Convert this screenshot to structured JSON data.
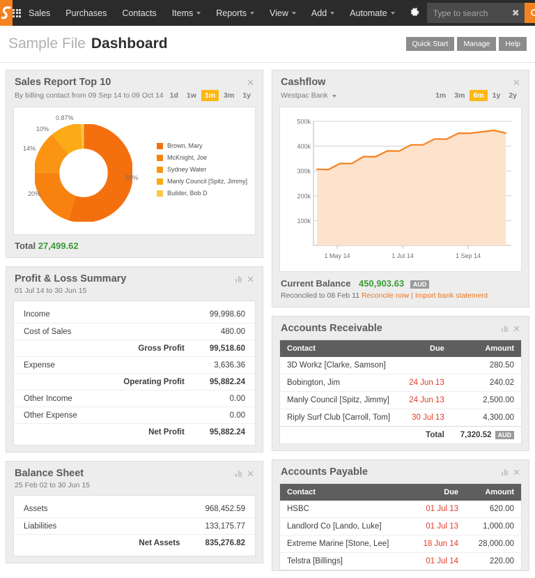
{
  "nav": {
    "logo": "logo-s-curve",
    "waffle": "apps-grid-icon",
    "items": [
      {
        "label": "Sales",
        "caret": false
      },
      {
        "label": "Purchases",
        "caret": false
      },
      {
        "label": "Contacts",
        "caret": false
      },
      {
        "label": "Items",
        "caret": true
      },
      {
        "label": "Reports",
        "caret": true
      },
      {
        "label": "View",
        "caret": true
      },
      {
        "label": "Add",
        "caret": true
      },
      {
        "label": "Automate",
        "caret": true
      }
    ],
    "gear": "gear-icon",
    "search": {
      "placeholder": "Type to search",
      "value": "",
      "clear": "✖",
      "button_icon": "search-icon"
    }
  },
  "header": {
    "file_name": "Sample File",
    "title": "Dashboard",
    "buttons": [
      "Quick Start",
      "Manage",
      "Help"
    ]
  },
  "sales_report": {
    "title": "Sales Report Top 10",
    "subtitle": "By billing contact from 09 Sep 14 to 09 Oct 14",
    "ranges": [
      "1d",
      "1w",
      "1m",
      "3m",
      "1y"
    ],
    "active_range": "1m",
    "total_label": "Total",
    "total_value": "27,499.62"
  },
  "cashflow": {
    "title": "Cashflow",
    "account": "Westpac Bank",
    "ranges": [
      "1m",
      "3m",
      "6m",
      "1y",
      "2y"
    ],
    "active_range": "6m",
    "balance_label": "Current Balance",
    "balance_value": "450,903.63",
    "currency": "AUD",
    "reconciled_text": "Reconciled to 08 Feb 11",
    "reconcile_link": "Reconcile now",
    "separator": "|",
    "import_link": "Import bank statement"
  },
  "profit_loss": {
    "title": "Profit & Loss Summary",
    "subtitle": "01 Jul 14 to 30 Jun 15",
    "rows": [
      {
        "label": "Income",
        "value": "99,998.60",
        "bold": false
      },
      {
        "label": "Cost of Sales",
        "value": "480.00",
        "bold": false
      },
      {
        "label": "Gross Profit",
        "value": "99,518.60",
        "bold": true
      },
      {
        "label": "Expense",
        "value": "3,636.36",
        "bold": false
      },
      {
        "label": "Operating Profit",
        "value": "95,882.24",
        "bold": true
      },
      {
        "label": "Other Income",
        "value": "0.00",
        "bold": false
      },
      {
        "label": "Other Expense",
        "value": "0.00",
        "bold": false
      },
      {
        "label": "Net Profit",
        "value": "95,882.24",
        "bold": true
      }
    ]
  },
  "balance_sheet": {
    "title": "Balance Sheet",
    "subtitle": "25 Feb 02 to 30 Jun 15",
    "rows": [
      {
        "label": "Assets",
        "value": "968,452.59",
        "bold": false
      },
      {
        "label": "Liabilities",
        "value": "133,175.77",
        "bold": false
      },
      {
        "label": "Net Assets",
        "value": "835,276.82",
        "bold": true
      }
    ]
  },
  "accounts_receivable": {
    "title": "Accounts Receivable",
    "columns": [
      "Contact",
      "Due",
      "Amount"
    ],
    "rows": [
      {
        "contact": "3D Workz [Clarke, Samson]",
        "due": "",
        "amount": "280.50"
      },
      {
        "contact": "Bobington, Jim",
        "due": "24 Jun 13",
        "amount": "240.02"
      },
      {
        "contact": "Manly Council [Spitz, Jimmy]",
        "due": "24 Jun 13",
        "amount": "2,500.00"
      },
      {
        "contact": "Riply Surf Club [Carroll, Tom]",
        "due": "30 Jul 13",
        "amount": "4,300.00"
      }
    ],
    "total_label": "Total",
    "total_value": "7,320.52",
    "currency": "AUD"
  },
  "accounts_payable": {
    "title": "Accounts Payable",
    "columns": [
      "Contact",
      "Due",
      "Amount"
    ],
    "rows": [
      {
        "contact": "HSBC",
        "due": "01 Jul 13",
        "amount": "620.00"
      },
      {
        "contact": "Landlord Co [Lando, Luke]",
        "due": "01 Jul 13",
        "amount": "1,000.00"
      },
      {
        "contact": "Extreme Marine [Stone, Lee]",
        "due": "18 Jun 14",
        "amount": "28,000.00"
      },
      {
        "contact": "Telstra [Billings]",
        "due": "01 Jul 14",
        "amount": "220.00"
      }
    ]
  },
  "chart_data": [
    {
      "type": "pie",
      "title": "Sales Report Top 10",
      "subtitle": "By billing contact from 09 Sep 14 to 09 Oct 14",
      "donut": true,
      "legend_position": "right",
      "labels": [
        "Brown, Mary",
        "McKnight, Joe",
        "Sydney Water",
        "Manly Council [Spitz, Jimmy]",
        "Builder, Bob D"
      ],
      "values": [
        55,
        20,
        14,
        10,
        0.87
      ],
      "value_labels": [
        "55%",
        "20%",
        "14%",
        "10%",
        "0.87%"
      ],
      "colors": [
        "#f4700f",
        "#f8820f",
        "#fa9412",
        "#fcaa16",
        "#fdc741"
      ],
      "total": "27,499.62"
    },
    {
      "type": "area",
      "title": "Cashflow",
      "series_name": "Westpac Bank",
      "xlabel": "",
      "ylabel": "",
      "ylim": [
        0,
        500000
      ],
      "ytick_labels": [
        "100k",
        "200k",
        "300k",
        "400k",
        "500k"
      ],
      "ytick_values": [
        100000,
        200000,
        300000,
        400000,
        500000
      ],
      "xtick_labels": [
        "1 May 14",
        "1 Jul 14",
        "1 Sep 14"
      ],
      "grid": true,
      "line_color": "#f58220",
      "fill_color": "#fde2cc",
      "x": [
        0,
        1,
        2,
        3,
        4,
        5,
        6,
        7,
        8,
        9,
        10,
        11,
        12,
        13,
        14,
        15,
        16
      ],
      "values": [
        307000,
        305000,
        330000,
        330000,
        358000,
        357000,
        381000,
        380000,
        405000,
        405000,
        429000,
        428000,
        452000,
        452000,
        452000,
        452000,
        452000
      ]
    }
  ]
}
